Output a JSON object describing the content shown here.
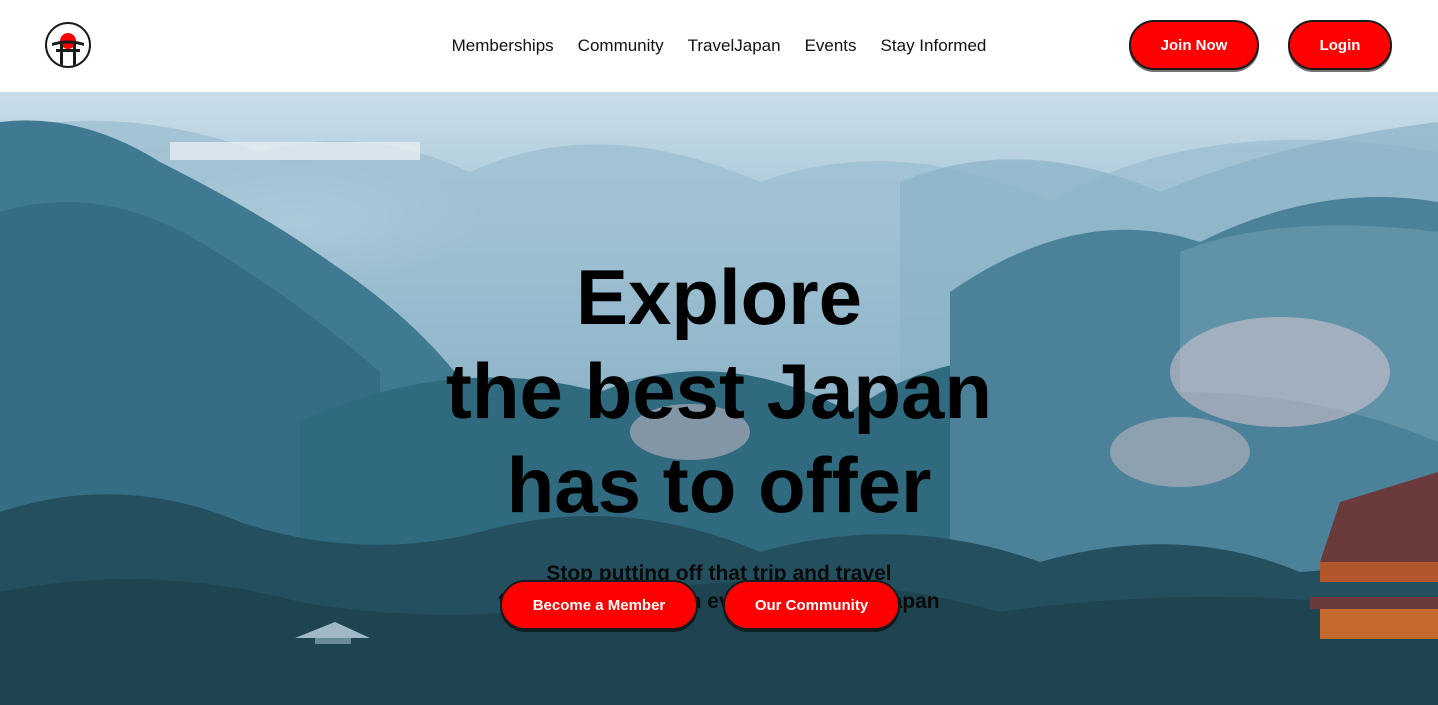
{
  "brand": {
    "logo_icon": "torii-sun-logo-icon",
    "accent_color": "#ff0000"
  },
  "nav": {
    "items": [
      {
        "label": "Memberships"
      },
      {
        "label": "Community"
      },
      {
        "label": "TravelJapan"
      },
      {
        "label": "Events"
      },
      {
        "label": "Stay Informed"
      }
    ]
  },
  "header": {
    "join_label": "Join Now",
    "login_label": "Login"
  },
  "hero": {
    "title_lines": [
      "Explore",
      "the best Japan",
      "has to offer"
    ],
    "subtitle_lines": [
      "Stop putting off that trip and travel",
      "to Japan easier than ever using TravelJapan"
    ],
    "primary_cta": "Become a Member",
    "secondary_cta": "Our Community"
  }
}
